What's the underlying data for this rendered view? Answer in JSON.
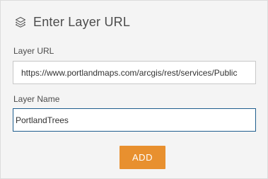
{
  "header": {
    "icon": "layers-icon",
    "title": "Enter Layer URL"
  },
  "form": {
    "url_label": "Layer URL",
    "url_value": "https://www.portlandmaps.com/arcgis/rest/services/Public",
    "name_label": "Layer Name",
    "name_value": "PortlandTrees",
    "add_label": "ADD"
  },
  "colors": {
    "accent": "#e8902f",
    "focus_border": "#1f5e8e",
    "panel_bg": "#f4f4f4"
  }
}
